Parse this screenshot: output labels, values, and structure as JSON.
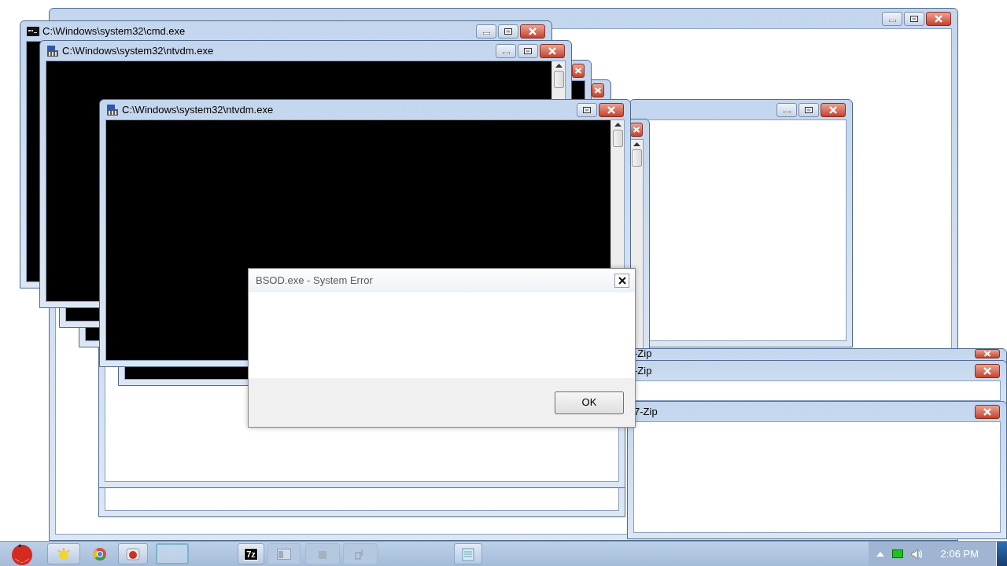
{
  "windows": [
    {
      "kind": "document",
      "buttons": [
        {
          "kind": "minimize"
        },
        {
          "kind": "maximize"
        },
        {
          "kind": "close"
        }
      ]
    },
    {
      "kind": "document"
    },
    {
      "kind": "document"
    },
    {
      "kind": "document",
      "buttons": [
        {
          "kind": "minimize"
        },
        {
          "kind": "maximize"
        },
        {
          "kind": "close"
        }
      ]
    },
    {
      "kind": "console",
      "scrollbar": true,
      "buttons": [
        {
          "kind": "close"
        }
      ]
    },
    {
      "kind": "console",
      "buttons": [
        {
          "kind": "close"
        }
      ]
    },
    {
      "kind": "console",
      "buttons": [
        {
          "kind": "close"
        }
      ]
    },
    {
      "kind": "cmd",
      "title": "C:\\Windows\\system32\\cmd.exe",
      "buttons": [
        {
          "kind": "minimize"
        },
        {
          "kind": "maximize"
        },
        {
          "kind": "close"
        }
      ]
    },
    {
      "kind": "dos",
      "title": "C:\\Windows\\system32\\ntvdm.exe",
      "scrollbar": true,
      "buttons": [
        {
          "kind": "minimize"
        },
        {
          "kind": "maximize"
        },
        {
          "kind": "close"
        }
      ]
    },
    {
      "kind": "dos",
      "title": "C:\\Windows\\system32\\ntvdm.exe",
      "scrollbar": true,
      "buttons": [
        {
          "kind": "maximize"
        },
        {
          "kind": "close"
        }
      ]
    },
    {
      "kind": "frame",
      "title": "-Zip",
      "buttons": [
        {
          "kind": "close"
        }
      ]
    },
    {
      "kind": "document",
      "title": "-Zip",
      "buttons": [
        {
          "kind": "close"
        }
      ]
    },
    {
      "kind": "document",
      "title": "7-Zip",
      "buttons": [
        {
          "kind": "close"
        }
      ]
    }
  ],
  "dialog": {
    "title": "BSOD.exe - System Error",
    "button": "OK"
  },
  "taskbar": {
    "buttons": [
      {
        "kind": "sun",
        "selected": false,
        "dimmed": false
      },
      {
        "kind": "globe",
        "selected": false,
        "dimmed": false
      },
      {
        "kind": "app",
        "selected": false,
        "dimmed": false
      },
      {
        "kind": "blank",
        "selected": true,
        "dimmed": false
      },
      {
        "kind": "archive",
        "label": "7z",
        "selected": false,
        "dimmed": false
      },
      {
        "kind": "window",
        "selected": false,
        "dimmed": true
      },
      {
        "kind": "tile",
        "selected": false,
        "dimmed": true
      },
      {
        "kind": "tool",
        "selected": false,
        "dimmed": true
      },
      {
        "kind": "notepad",
        "selected": false,
        "dimmed": false
      }
    ],
    "clock": "2:06 PM"
  }
}
